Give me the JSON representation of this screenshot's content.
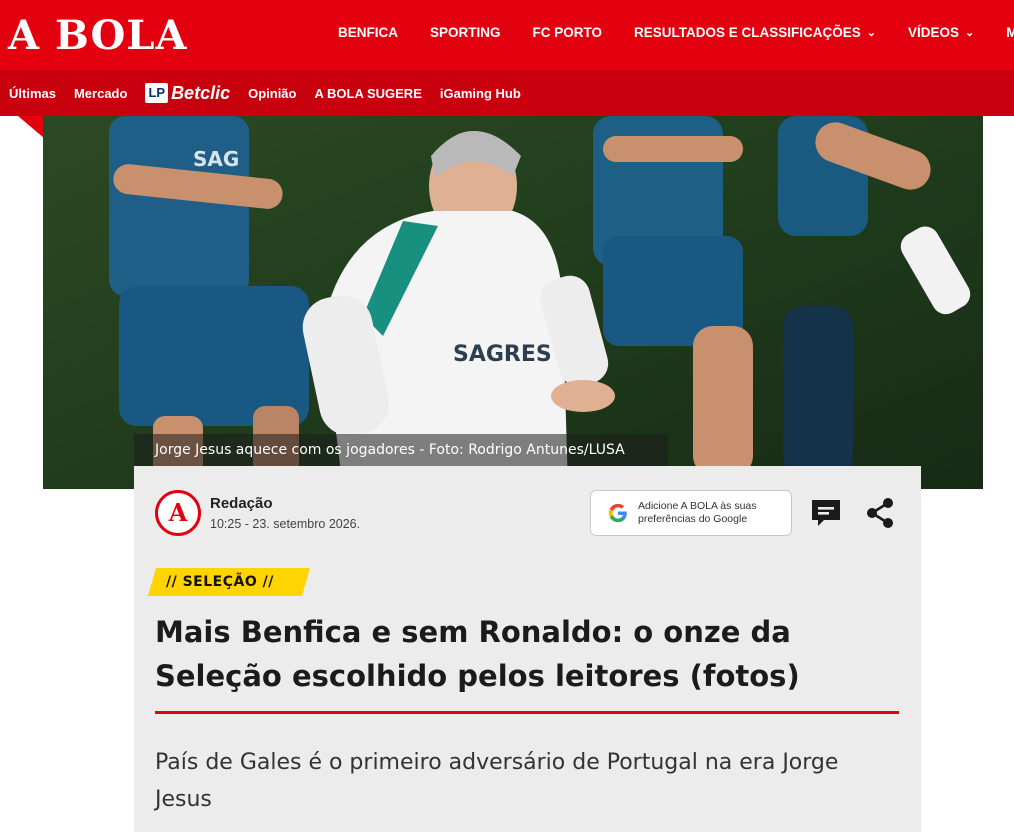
{
  "header": {
    "logo": "A BOLA",
    "main_nav": [
      {
        "label": "BENFICA",
        "dropdown": false
      },
      {
        "label": "SPORTING",
        "dropdown": false
      },
      {
        "label": "FC PORTO",
        "dropdown": false
      },
      {
        "label": "RESULTADOS E CLASSIFICAÇÕES",
        "dropdown": true
      },
      {
        "label": "VÍDEOS",
        "dropdown": true
      },
      {
        "label": "M",
        "dropdown": false
      }
    ],
    "chevron": "⌄",
    "sub_nav_left": [
      "Últimas",
      "Mercado"
    ],
    "sponsor": {
      "badge": "LP",
      "name": "Betclic"
    },
    "sub_nav_right": [
      "Opinião",
      "A BOLA SUGERE",
      "iGaming Hub"
    ]
  },
  "hero": {
    "caption": "Jorge Jesus aquece com os jogadores - Foto: Rodrigo Antunes/LUSA",
    "shirt_text": "SAGRES"
  },
  "article": {
    "author_badge": "A",
    "author": "Redação",
    "datetime": "10:25 - 23. setembro 2026.",
    "google_button": {
      "line1": "Adicione A BOLA às suas",
      "line2": "preferências do Google"
    },
    "section": "// SELEÇÃO //",
    "headline": "Mais Benfica e sem Ronaldo: o onze da Seleção escolhido pelos leitores (fotos)",
    "lead": "País de Gales é o primeiro adversário de Portugal na era Jorge Jesus"
  },
  "colors": {
    "brand_red": "#e3000f",
    "sub_red": "#c8000d",
    "section_yellow": "#ffd400",
    "card_bg": "#ececec"
  },
  "icons": [
    "google-icon",
    "comment-icon",
    "share-icon",
    "chevron-down-icon"
  ]
}
